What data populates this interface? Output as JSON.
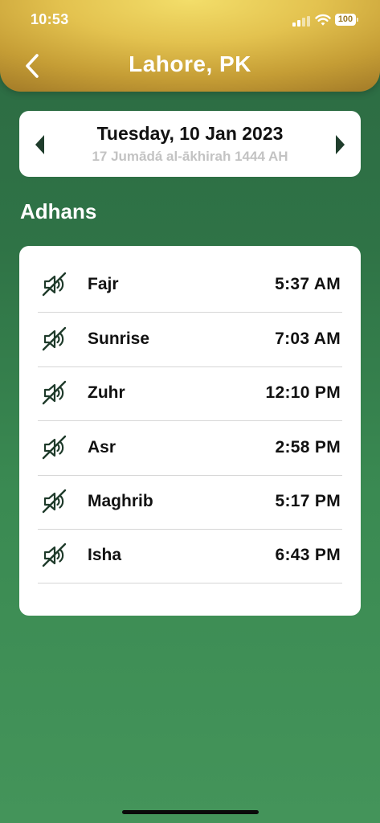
{
  "status_bar": {
    "time": "10:53",
    "battery": "100",
    "signal_icon": "cellular-signal-icon",
    "wifi_icon": "wifi-icon"
  },
  "header": {
    "title": "Lahore, PK",
    "back_icon": "chevron-left-icon"
  },
  "date_card": {
    "gregorian": "Tuesday, 10 Jan 2023",
    "hijri": "17 Jumādá al-ākhirah 1444 AH",
    "prev_icon": "triangle-left-icon",
    "next_icon": "triangle-right-icon"
  },
  "section": {
    "title": "Adhans"
  },
  "prayers": [
    {
      "name": "Fajr",
      "time": "5:37 AM",
      "icon": "speaker-muted-icon"
    },
    {
      "name": "Sunrise",
      "time": "7:03 AM",
      "icon": "speaker-muted-icon"
    },
    {
      "name": "Zuhr",
      "time": "12:10 PM",
      "icon": "speaker-muted-icon"
    },
    {
      "name": "Asr",
      "time": "2:58 PM",
      "icon": "speaker-muted-icon"
    },
    {
      "name": "Maghrib",
      "time": "5:17 PM",
      "icon": "speaker-muted-icon"
    },
    {
      "name": "Isha",
      "time": "6:43 PM",
      "icon": "speaker-muted-icon"
    }
  ],
  "colors": {
    "header_gold": "#e3c24f",
    "background_green": "#2f7346",
    "icon_dark_green": "#1e3a2a",
    "hijri_gray": "#c3c3c3"
  }
}
